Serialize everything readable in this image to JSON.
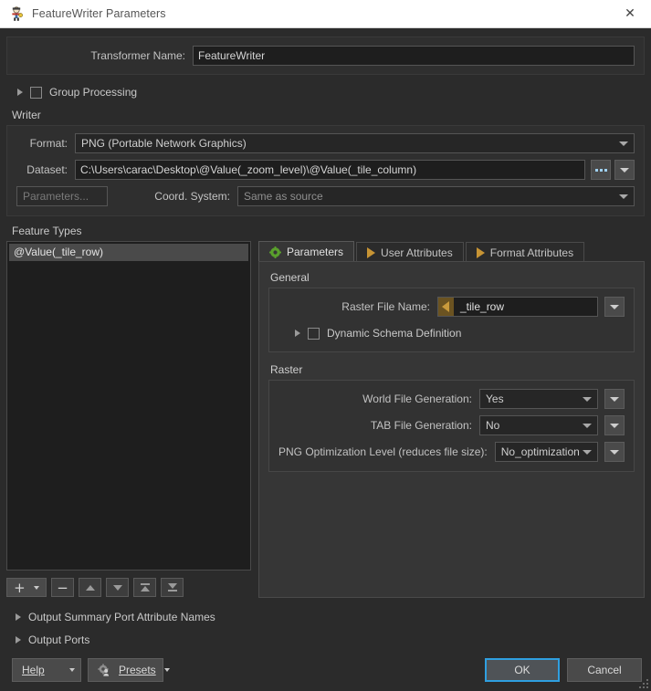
{
  "window": {
    "title": "FeatureWriter Parameters",
    "icon": "transformer-icon",
    "close_label": "✕"
  },
  "transformer": {
    "name_label": "Transformer Name:",
    "name_value": "FeatureWriter"
  },
  "group_processing": {
    "label": "Group Processing",
    "checked": false,
    "expanded": false
  },
  "writer": {
    "section_label": "Writer",
    "format_label": "Format:",
    "format_value": "PNG (Portable Network Graphics)",
    "dataset_label": "Dataset:",
    "dataset_value": "C:\\Users\\carac\\Desktop\\@Value(_zoom_level)\\@Value(_tile_column)",
    "browse_label": "...",
    "parameters_button": "Parameters...",
    "coord_system_label": "Coord. System:",
    "coord_system_value": "Same as source"
  },
  "feature_types": {
    "section_label": "Feature Types",
    "items": [
      {
        "label": "@Value(_tile_row)",
        "selected": true
      }
    ],
    "toolbar": {
      "add": "+",
      "remove": "−",
      "move_up": "move-up",
      "move_down": "move-down",
      "move_top": "move-to-top",
      "move_bottom": "move-to-bottom"
    }
  },
  "tabs": [
    {
      "label": "Parameters",
      "icon": "gear-icon",
      "active": true
    },
    {
      "label": "User Attributes",
      "icon": "arrow-right-icon",
      "active": false
    },
    {
      "label": "Format Attributes",
      "icon": "arrow-right-icon",
      "active": false
    }
  ],
  "parameters_pane": {
    "general": {
      "title": "General",
      "raster_file_name_label": "Raster File Name:",
      "raster_file_name_value": "_tile_row",
      "dynamic_schema_label": "Dynamic Schema Definition",
      "dynamic_schema_checked": false
    },
    "raster": {
      "title": "Raster",
      "rows": [
        {
          "label": "World File Generation:",
          "value": "Yes"
        },
        {
          "label": "TAB File Generation:",
          "value": "No"
        },
        {
          "label": "PNG Optimization Level (reduces file size):",
          "value": "No_optimization"
        }
      ]
    }
  },
  "collapsed_sections": [
    {
      "label": "Output Summary Port Attribute Names"
    },
    {
      "label": "Output Ports"
    }
  ],
  "footer": {
    "help": "Help",
    "help_mnemonic": "H",
    "presets": "Presets",
    "presets_mnemonic": "P",
    "ok": "OK",
    "cancel": "Cancel"
  },
  "colors": {
    "window_bg": "#2b2b2b",
    "panel_bg": "#2f2f2f",
    "tab_pane_bg": "#363636",
    "field_bg": "#1e1e1e",
    "accent_focus": "#2f9fe0",
    "attribute_amber": "#c99a3c",
    "gear_green": "#5aa02c",
    "titlebar_bg": "#ffffff"
  }
}
